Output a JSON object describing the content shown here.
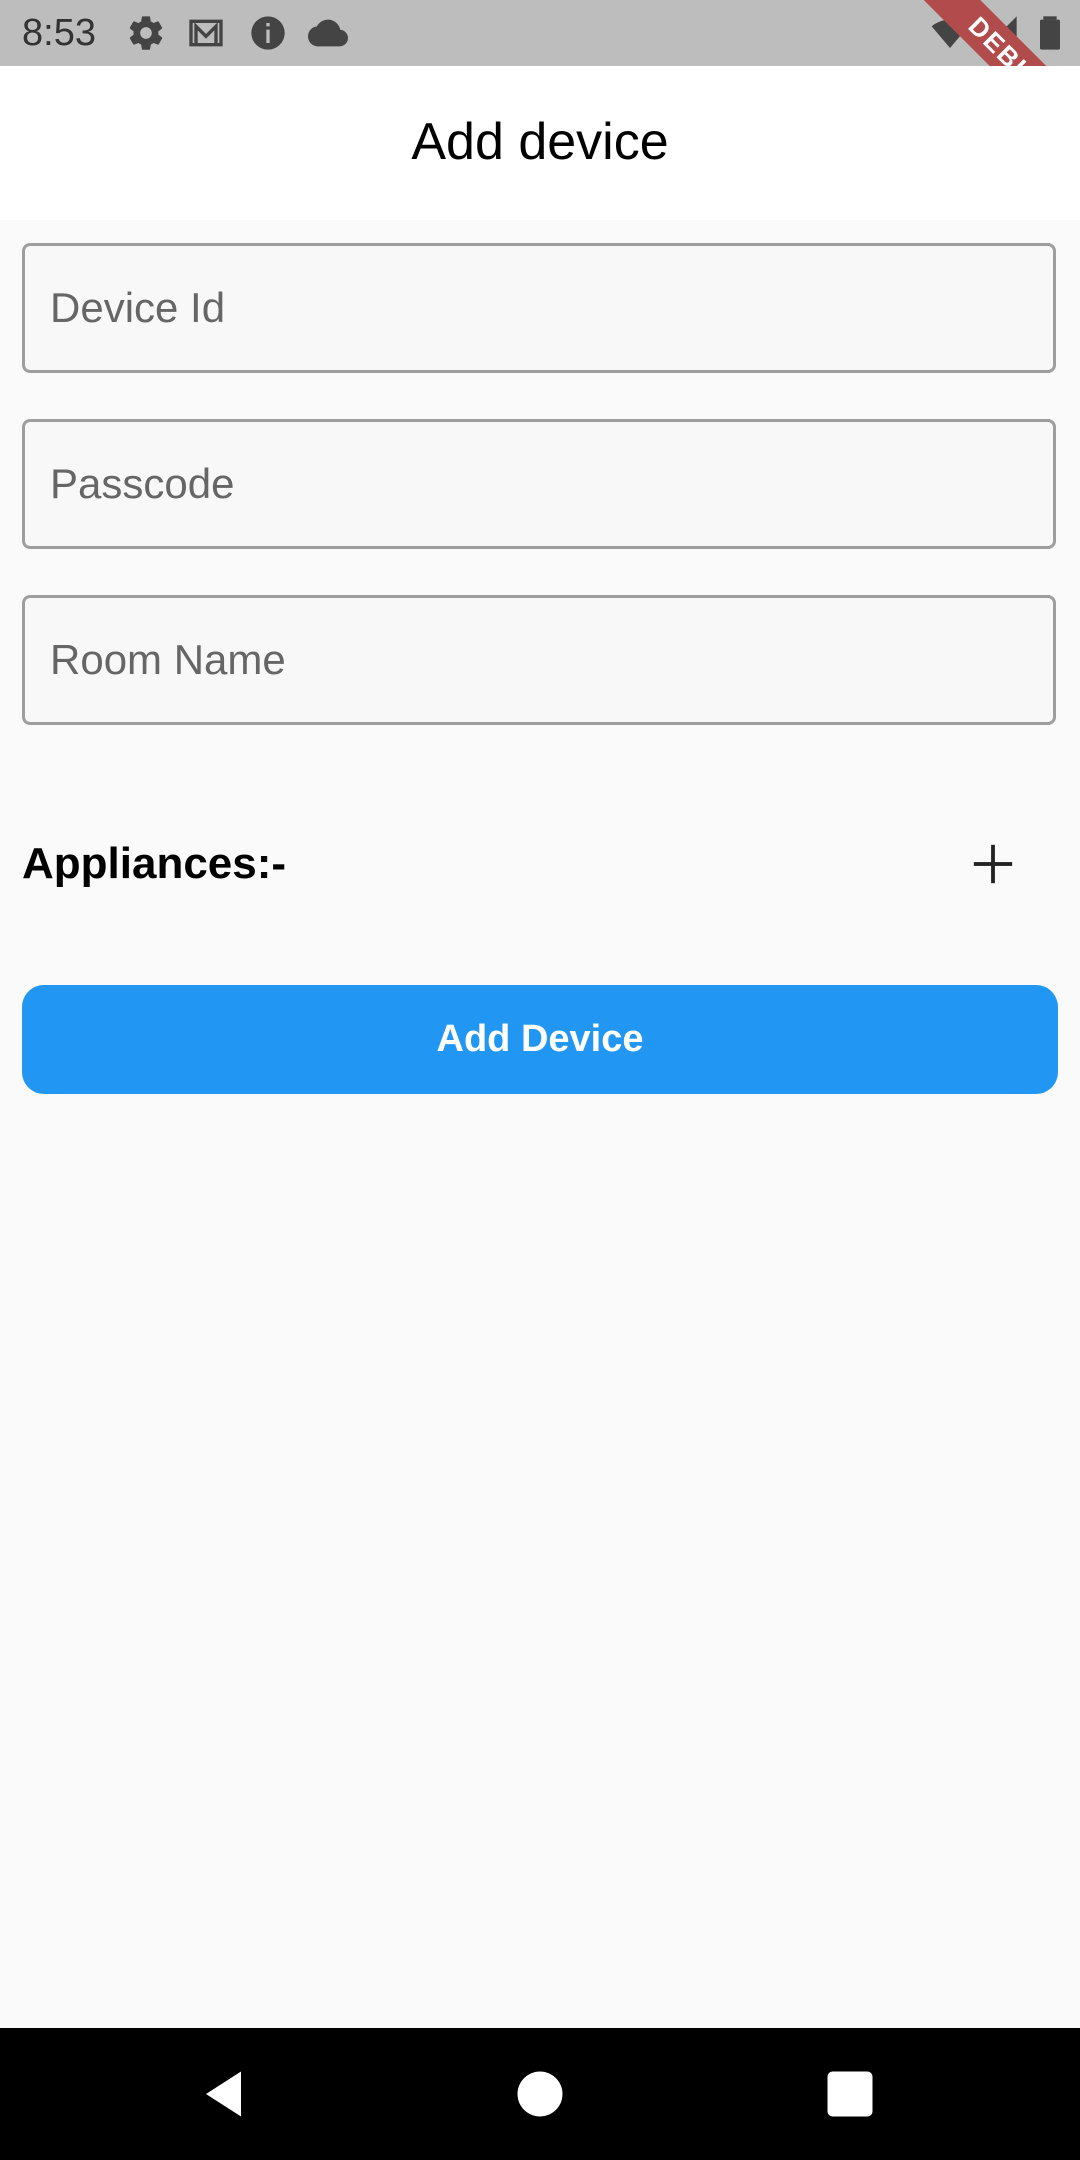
{
  "status_bar": {
    "time": "8:53",
    "icons": [
      "gear-icon",
      "gmail-icon",
      "info-icon",
      "cloud-icon",
      "wifi-icon",
      "cell-signal-icon",
      "battery-icon"
    ],
    "debug_banner": "DEBUG"
  },
  "app_bar": {
    "title": "Add device"
  },
  "form": {
    "device_id_placeholder": "Device Id",
    "passcode_placeholder": "Passcode",
    "room_name_placeholder": "Room Name"
  },
  "appliances": {
    "label": "Appliances:-",
    "add_icon": "plus-icon"
  },
  "submit": {
    "label": "Add Device"
  },
  "nav_bar": {
    "icons": [
      "back-icon",
      "home-icon",
      "recents-icon"
    ]
  },
  "colors": {
    "accent": "#2196f3",
    "status_bar": "#bdbdbd",
    "debug_ribbon": "#b24c4c"
  }
}
